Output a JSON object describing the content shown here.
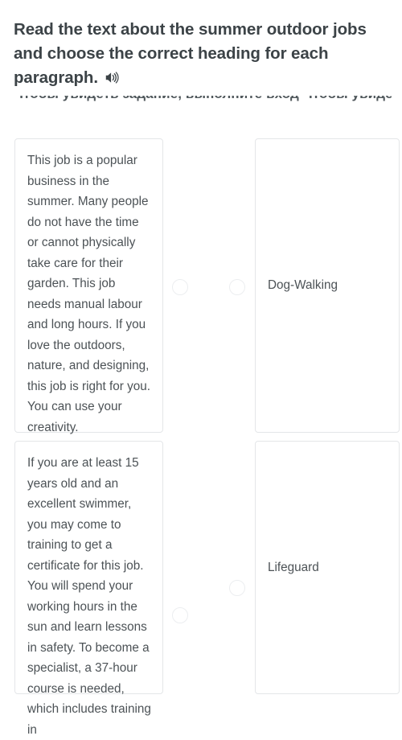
{
  "exercise": {
    "prompt": "Read the text about the summer outdoor jobs and choose the correct heading for each paragraph.",
    "audio_icon": "speaker-icon",
    "obscured_line": "Чтобы увидеть задание, выполните вход  Чтобы увидеть задание, выполните вход"
  },
  "rows": [
    {
      "paragraph": "This job is a popular business in the summer. Many people do not have the time or cannot physically take care for their garden. This job needs manual labour and long hours. If you love the outdoors, nature, and designing, this job is right for you. You can use your creativity.",
      "answer": "Dog-Walking",
      "left_radio_selected": false,
      "right_radio_selected": false
    },
    {
      "paragraph": "If you are at least 15 years old and an excellent swimmer, you may come to training to get a certificate for this job. You will spend your working hours in the sun and learn lessons in safety. To become a specialist, a 37-hour course is needed, which includes training in",
      "answer": "Lifeguard",
      "left_radio_selected": false,
      "right_radio_selected": false
    }
  ],
  "colors": {
    "heading": "#3c4347",
    "body_text": "#4c5256",
    "card_border": "#e4e6e8",
    "radio_border": "#eceef0",
    "background": "#ffffff"
  }
}
